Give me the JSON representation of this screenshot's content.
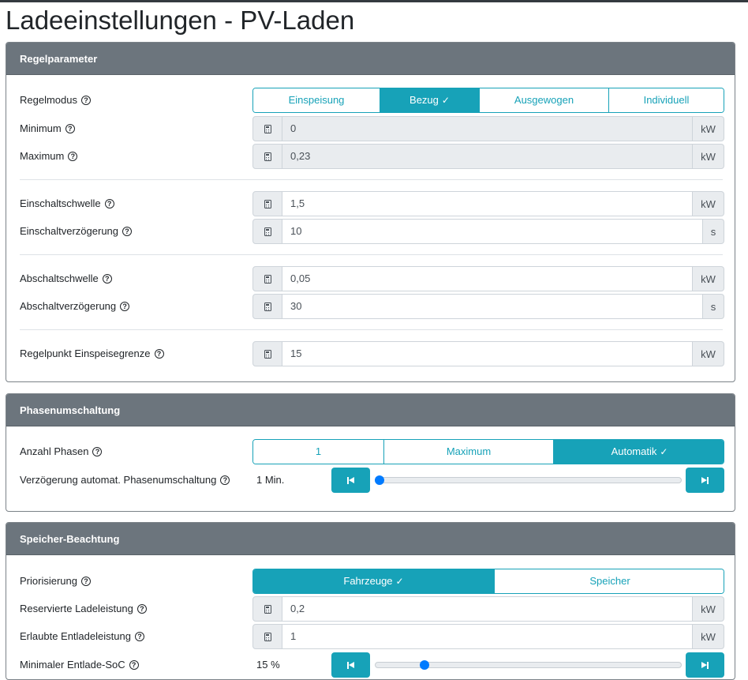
{
  "page": {
    "title": "Ladeeinstellungen - PV-Laden"
  },
  "icons": {
    "help": "help-circle-icon",
    "calculator": "calculator-icon",
    "check": "check-icon",
    "prev": "skip-back-icon",
    "next": "skip-forward-icon"
  },
  "colors": {
    "header": "#6c757d",
    "accent": "#17a2b8",
    "thumb": "#007bff"
  },
  "regelparameter": {
    "title": "Regelparameter",
    "regelmodus": {
      "label": "Regelmodus",
      "options": [
        "Einspeisung",
        "Bezug",
        "Ausgewogen",
        "Individuell"
      ],
      "selected": "Bezug"
    },
    "minimum": {
      "label": "Minimum",
      "value": "0",
      "unit": "kW"
    },
    "maximum": {
      "label": "Maximum",
      "value": "0,23",
      "unit": "kW"
    },
    "einschaltschwelle": {
      "label": "Einschaltschwelle",
      "value": "1,5",
      "unit": "kW"
    },
    "einschaltverzoegerung": {
      "label": "Einschaltverzögerung",
      "value": "10",
      "unit": "s"
    },
    "abschaltschwelle": {
      "label": "Abschaltschwelle",
      "value": "0,05",
      "unit": "kW"
    },
    "abschaltverzoegerung": {
      "label": "Abschaltverzögerung",
      "value": "30",
      "unit": "s"
    },
    "regelpunkt": {
      "label": "Regelpunkt Einspeisegrenze",
      "value": "15",
      "unit": "kW"
    }
  },
  "phasenumschaltung": {
    "title": "Phasenumschaltung",
    "anzahl_phasen": {
      "label": "Anzahl Phasen",
      "options": [
        "1",
        "Maximum",
        "Automatik"
      ],
      "selected": "Automatik"
    },
    "verzoegerung": {
      "label": "Verzögerung automat. Phasenumschaltung",
      "value_text": "1 Min.",
      "fraction": 0.0
    }
  },
  "speicher": {
    "title": "Speicher-Beachtung",
    "priorisierung": {
      "label": "Priorisierung",
      "options": [
        "Fahrzeuge",
        "Speicher"
      ],
      "selected": "Fahrzeuge"
    },
    "reservierte": {
      "label": "Reservierte Ladeleistung",
      "value": "0,2",
      "unit": "kW"
    },
    "erlaubte": {
      "label": "Erlaubte Entladeleistung",
      "value": "1",
      "unit": "kW"
    },
    "minimaler_soc": {
      "label": "Minimaler Entlade-SoC",
      "value_text": "15 %",
      "fraction": 0.15
    }
  }
}
